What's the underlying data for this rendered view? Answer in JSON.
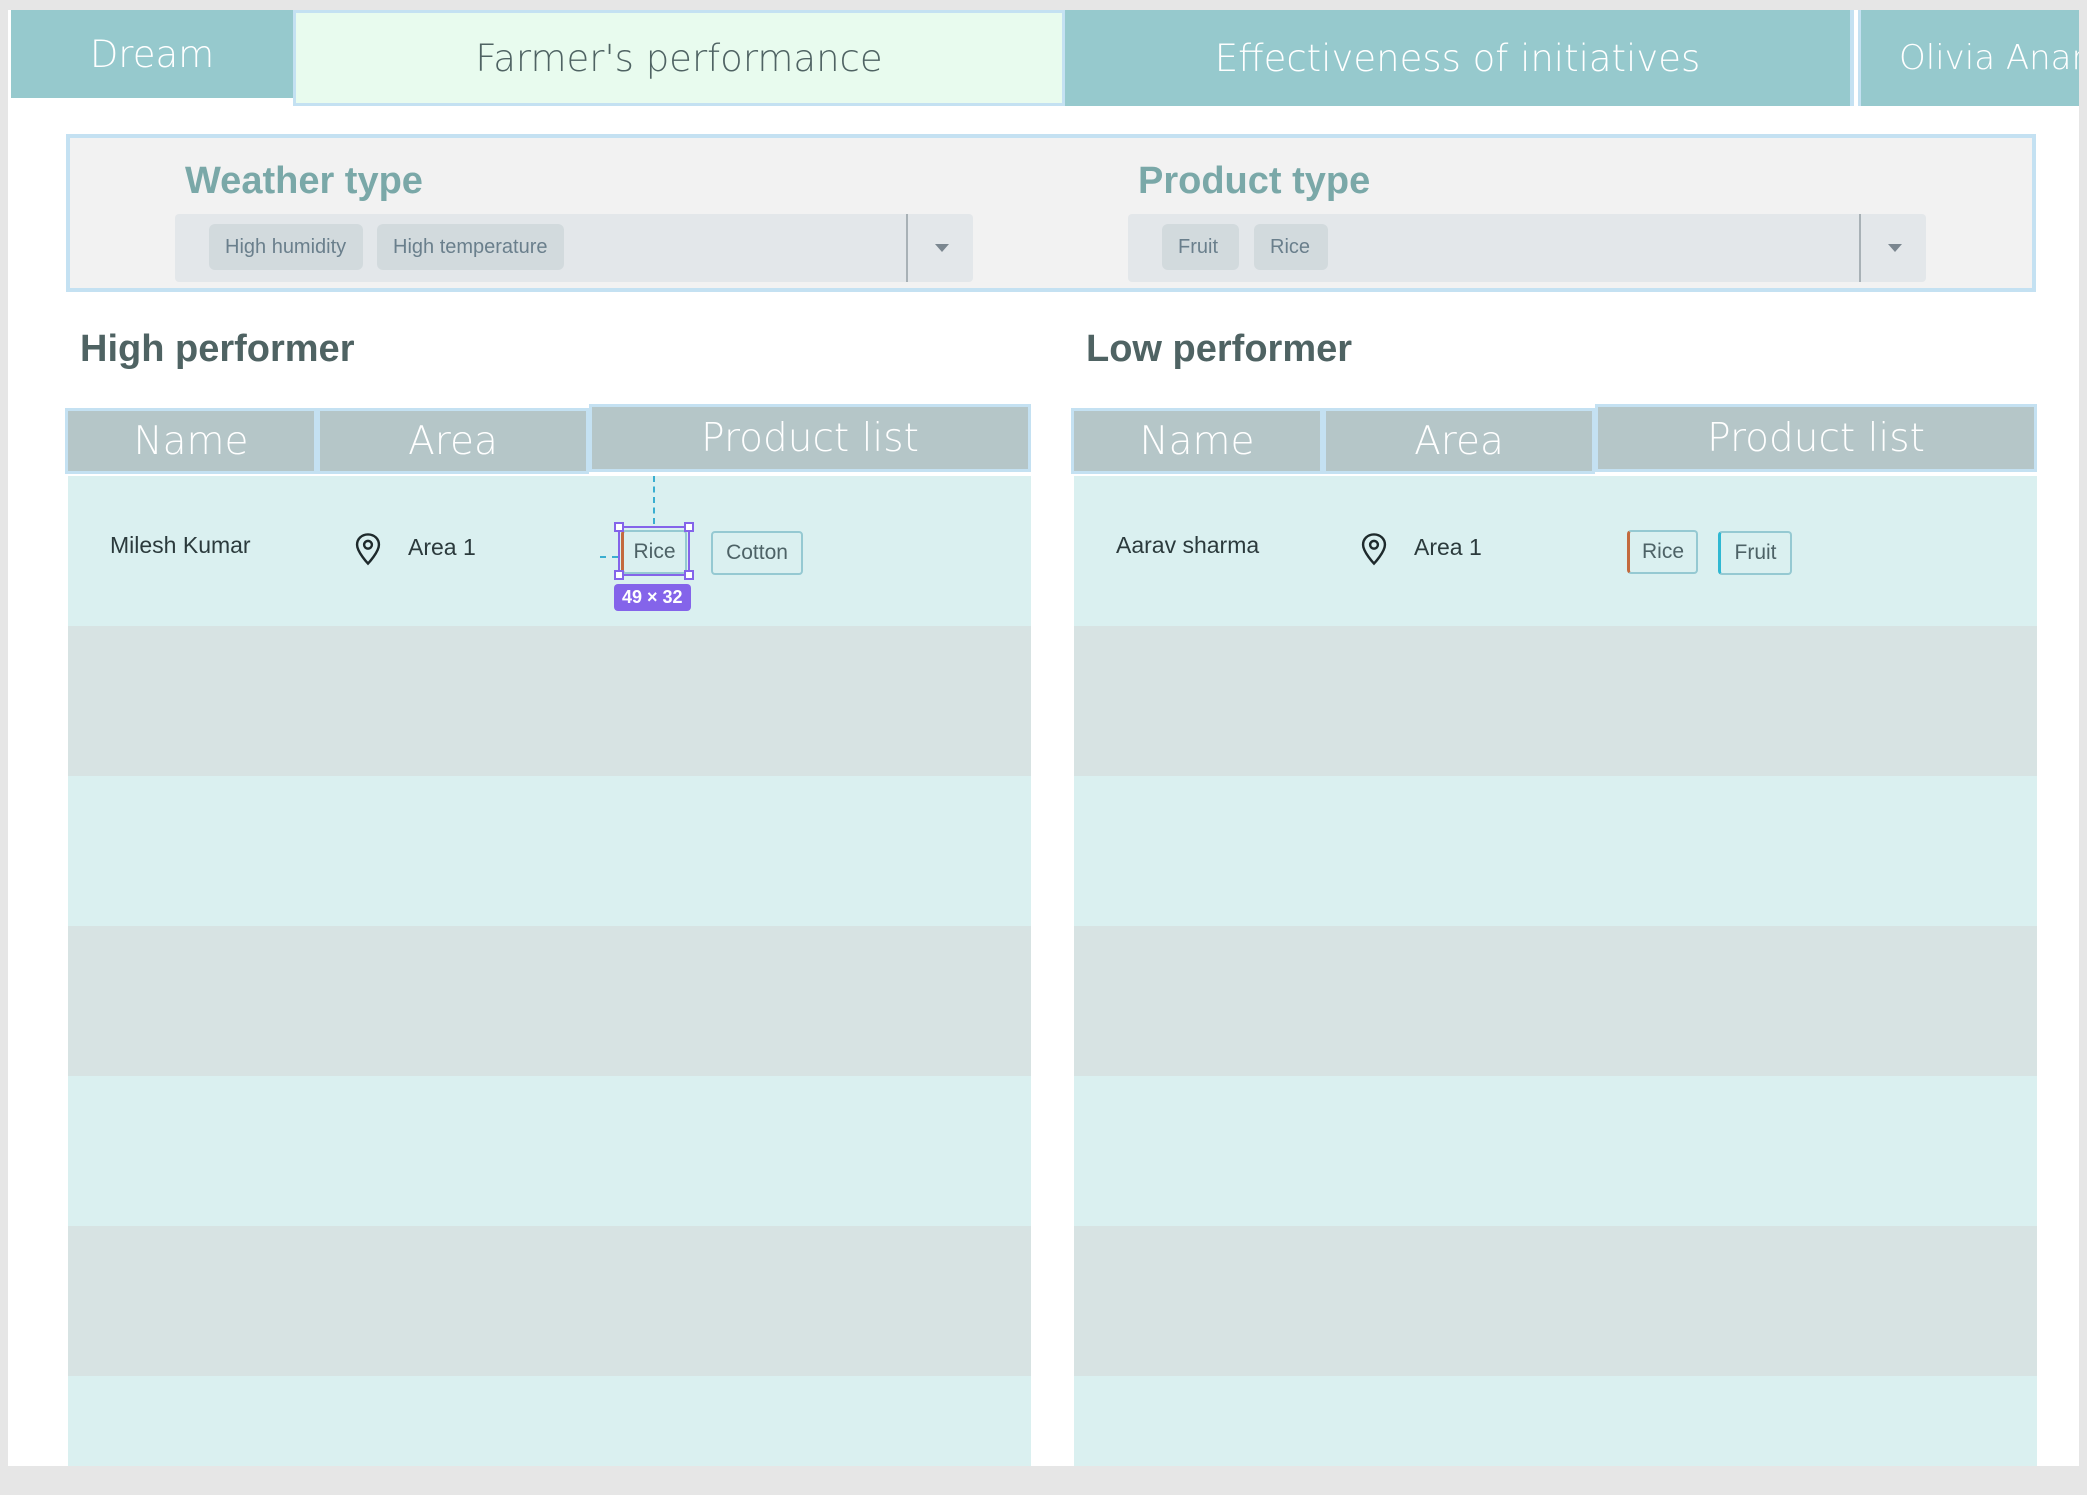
{
  "nav": {
    "brand": "Dream",
    "tabs": [
      "Farmer's performance",
      "Effectiveness of initiatives"
    ],
    "user": "Olivia Anand"
  },
  "filters": {
    "weather": {
      "title": "Weather type",
      "chips": [
        "High humidity",
        "High temperature"
      ]
    },
    "product": {
      "title": "Product type",
      "chips": [
        "Fruit",
        "Rice"
      ]
    }
  },
  "high": {
    "title": "High performer",
    "headers": [
      "Name",
      "Area",
      "Product list"
    ],
    "row": {
      "name": "Milesh Kumar",
      "area": "Area 1",
      "products": [
        "Rice",
        "Cotton"
      ]
    }
  },
  "low": {
    "title": "Low performer",
    "headers": [
      "Name",
      "Area",
      "Product list"
    ],
    "row": {
      "name": "Aarav sharma",
      "area": "Area 1",
      "products": [
        "Rice",
        "Fruit"
      ]
    }
  },
  "selection": {
    "dimensions": "49 × 32"
  },
  "colors": {
    "nav_bg": "#96c9cd",
    "active_tab_bg": "#e8fbee",
    "header_bg": "#b5c6c8",
    "row_light": "#daf0f0",
    "row_dark": "#d7e3e3",
    "selection": "#8464ea"
  },
  "icons": [
    "location-pin-icon",
    "chevron-down-icon"
  ]
}
